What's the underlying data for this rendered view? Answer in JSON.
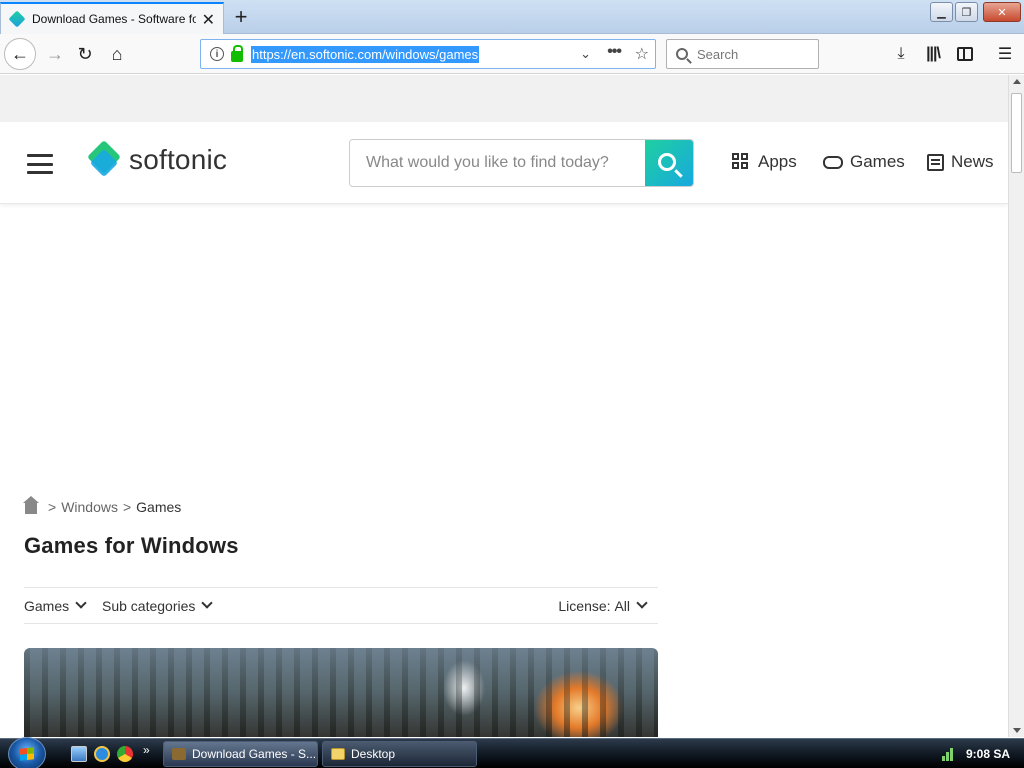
{
  "browser": {
    "tab_title": "Download Games - Software fo",
    "url": "https://en.softonic.com/windows/games",
    "search_placeholder": "Search",
    "icons": {
      "back": "arrow-left-icon",
      "forward": "arrow-right-icon",
      "reload": "reload-icon",
      "home": "home-icon",
      "star": "bookmark-star-icon",
      "more": "ellipsis-icon",
      "download": "download-icon",
      "library": "library-icon",
      "sidebar": "sidebar-icon",
      "menu": "hamburger-menu-icon"
    }
  },
  "site": {
    "logo_text": "softonic",
    "search_placeholder": "What would you like to find today?",
    "nav": [
      {
        "label": "Apps",
        "icon": "grid-icon"
      },
      {
        "label": "Games",
        "icon": "gamepad-icon"
      },
      {
        "label": "News",
        "icon": "news-icon"
      }
    ],
    "colors": {
      "accent_green": "#26c77a",
      "accent_blue": "#18a9e2"
    }
  },
  "breadcrumb": {
    "items": [
      "Windows",
      "Games"
    ],
    "separator": ">"
  },
  "page_title": "Games for Windows",
  "filters": {
    "games": "Games",
    "subcategories": "Sub categories",
    "license_label": "License:",
    "license_value": "All"
  },
  "taskbar": {
    "active_task": "Download Games - S...",
    "desktop_task": "Desktop",
    "clock": "9:08 SA",
    "quicklaunch_more": "»"
  }
}
